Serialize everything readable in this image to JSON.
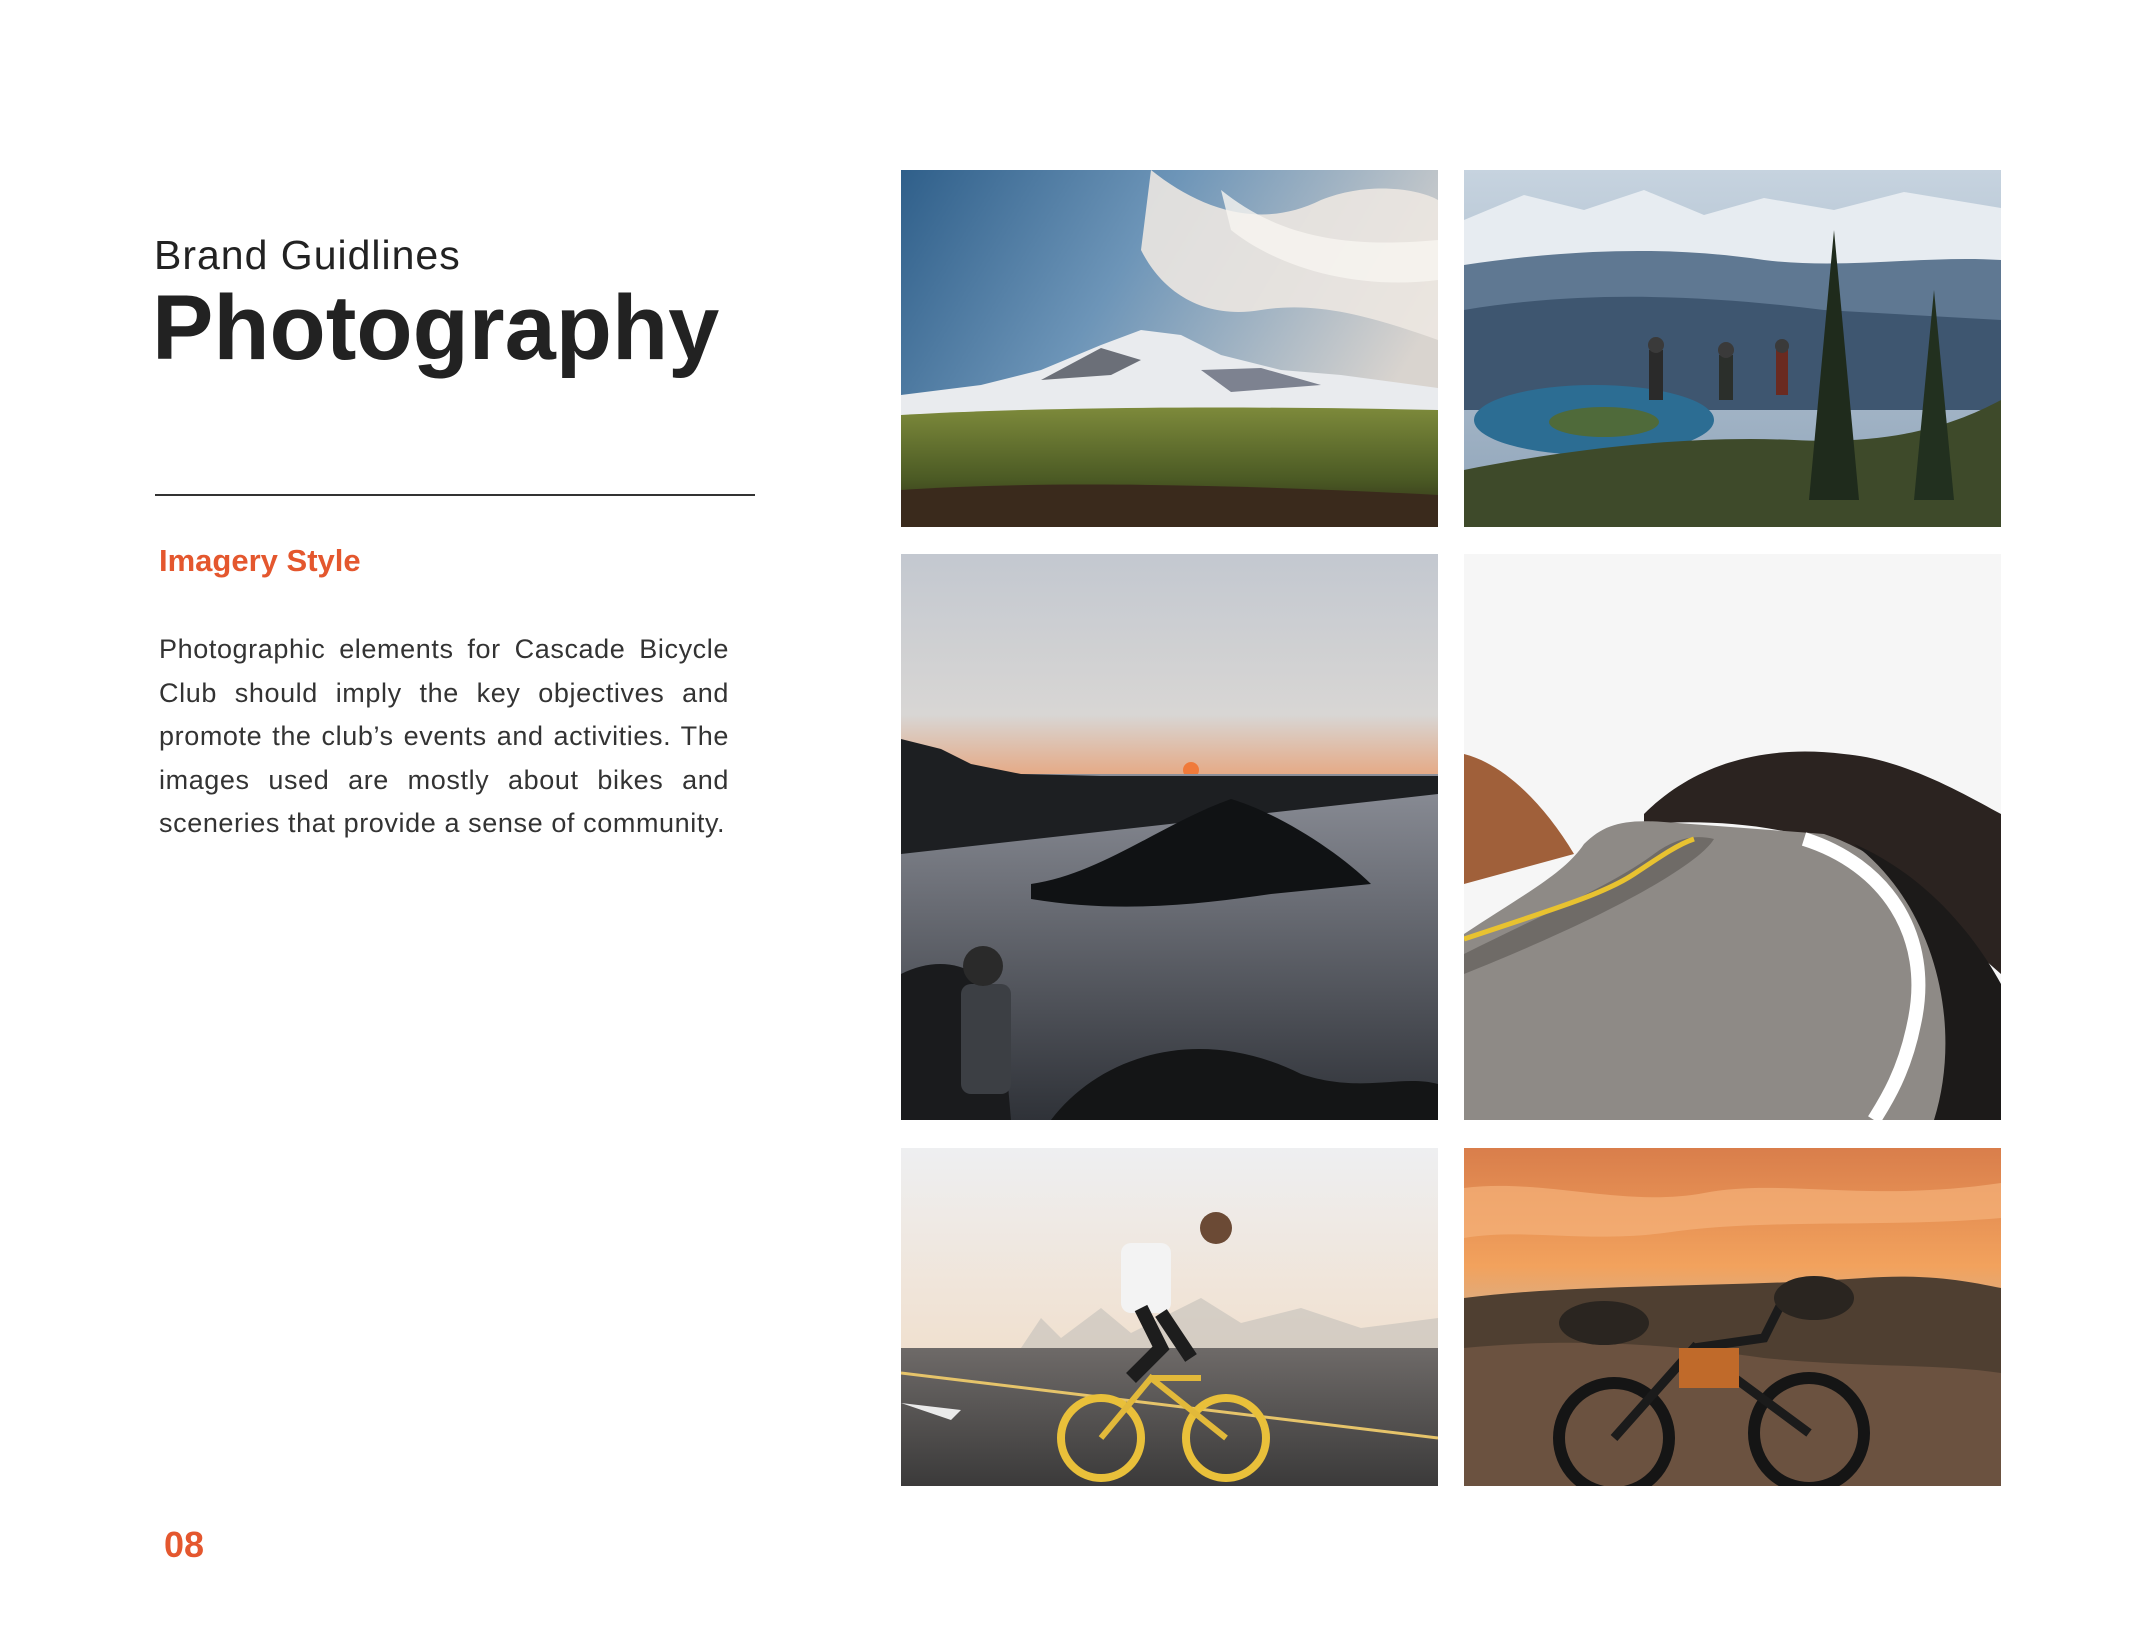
{
  "header": {
    "subtitle": "Brand Guidlines",
    "title": "Photography"
  },
  "section": {
    "heading": "Imagery Style",
    "body": "Photographic elements for Cascade Bicycle Club should imply the key objectives and promote the club’s events and activities. The images used are mostly about bikes and sceneries that provide a sense of community."
  },
  "footer": {
    "page_number": "08"
  },
  "colors": {
    "accent": "#e4572e",
    "text": "#222222"
  },
  "photos": [
    {
      "subject": "snowy-mountain-meadow-photo"
    },
    {
      "subject": "cyclists-overlooking-lake-photo"
    },
    {
      "subject": "sunset-lake-island-photo"
    },
    {
      "subject": "winding-road-photo"
    },
    {
      "subject": "road-cyclist-photo"
    },
    {
      "subject": "bikepacking-bike-sunset-photo"
    }
  ]
}
